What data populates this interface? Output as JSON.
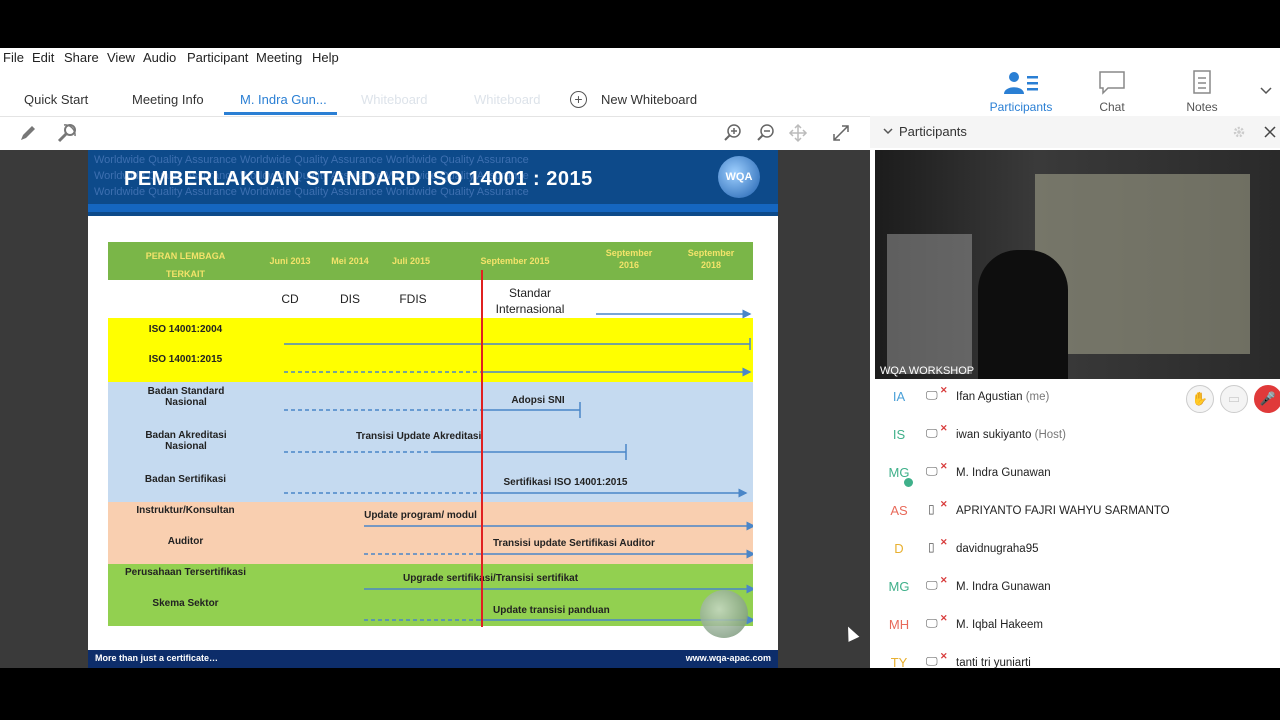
{
  "menu": [
    "File",
    "Edit",
    "Share",
    "View",
    "Audio",
    "Participant",
    "Meeting",
    "Help"
  ],
  "tabs": {
    "quick_start": "Quick Start",
    "meeting_info": "Meeting Info",
    "active_share": "M. Indra Gun...",
    "whiteboard1": "Whiteboard",
    "whiteboard2": "Whiteboard",
    "new_whiteboard": "New Whiteboard"
  },
  "right_tabs": {
    "participants": "Participants",
    "chat": "Chat",
    "notes": "Notes"
  },
  "colors": {
    "accent": "#2a7fd4",
    "slide_blue": "#0d4a8a",
    "yellow_band": "#ffff00",
    "blue_band": "#c5daf0",
    "peach_band": "#f9cfb0",
    "green_band": "#92d050",
    "red_line": "#e02020"
  },
  "slide": {
    "watermark": "Worldwide Quality Assurance",
    "title": "PEMBERLAKUAN STANDARD ISO 14001 : 2015",
    "logo": "WQA",
    "footer_left": "More than just  a certificate…",
    "footer_right": "www.wqa-apac.com",
    "header_row": {
      "role": "PERAN LEMBAGA TERKAIT",
      "dates": [
        "Juni 2013",
        "Mei 2014",
        "Juli 2015",
        "September 2015",
        "September 2016",
        "September 2018"
      ]
    },
    "stages": [
      "CD",
      "DIS",
      "FDIS",
      "Standar Internasional"
    ],
    "rows": {
      "iso2004": "ISO  14001:2004",
      "iso2015": "ISO 14001:2015",
      "bsn": "Badan  Standard Nasional",
      "bsn_note": "Adopsi SNI",
      "kan": "Badan Akreditasi Nasional",
      "kan_note": "Transisi Update Akreditasi",
      "bs": "Badan Sertifikasi",
      "bs_note": "Sertifikasi ISO 14001:2015",
      "instr": "Instruktur/Konsultan",
      "instr_note": "Update program/ modul",
      "auditor": "Auditor",
      "auditor_note": "Transisi update Sertifikasi Auditor",
      "perus": "Perusahaan Tersertifikasi",
      "perus_note": "Upgrade sertifikasi/Transisi sertifikat",
      "skema": "Skema Sektor",
      "skema_note": "Update transisi panduan"
    }
  },
  "sidebar": {
    "title": "Participants",
    "video_label": "WQA WORKSHOP",
    "participants": [
      {
        "initials": "IA",
        "name": "Ifan Agustian",
        "role": "(me)",
        "color": "#4aa0d8"
      },
      {
        "initials": "IS",
        "name": "iwan sukiyanto",
        "role": "(Host)",
        "color": "#3fb08a"
      },
      {
        "initials": "MG",
        "name": "M. Indra Gunawan",
        "role": "",
        "color": "#3fb08a"
      },
      {
        "initials": "AS",
        "name": "APRIYANTO FAJRI WAHYU SARMANTO",
        "role": "",
        "color": "#e86a5a"
      },
      {
        "initials": "D",
        "name": "davidnugraha95",
        "role": "",
        "color": "#e8b030"
      },
      {
        "initials": "MG",
        "name": "M. Indra Gunawan",
        "role": "",
        "color": "#3fb08a"
      },
      {
        "initials": "MH",
        "name": "M. Iqbal Hakeem",
        "role": "",
        "color": "#e86a5a"
      },
      {
        "initials": "TY",
        "name": "tanti tri yuniarti",
        "role": "",
        "color": "#e8b030"
      }
    ]
  }
}
